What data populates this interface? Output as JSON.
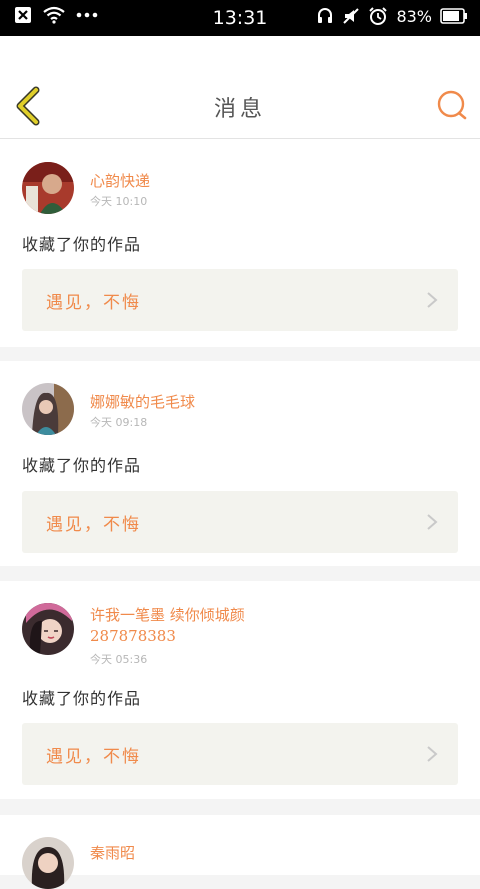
{
  "status_bar": {
    "time": "13:31",
    "battery": "83%"
  },
  "header": {
    "title": "消息"
  },
  "messages": [
    {
      "username": "心韵快递",
      "time": "今天 10:10",
      "action": "收藏了你的作品",
      "work_title": "遇见，不悔"
    },
    {
      "username": "娜娜敏的毛毛球",
      "time": "今天 09:18",
      "action": "收藏了你的作品",
      "work_title": "遇见，不悔"
    },
    {
      "username": "许我一笔墨 续你倾城颜",
      "username_line2": "287878383",
      "time": "今天 05:36",
      "action": "收藏了你的作品",
      "work_title": "遇见，不悔"
    },
    {
      "username": "秦雨昭"
    }
  ],
  "colors": {
    "accent": "#f08a4b",
    "back_arrow": "#e0cf2a",
    "quote_bg": "#f3f3ee"
  },
  "icons": [
    "wifi-icon",
    "more-dots-icon",
    "headphone-icon",
    "mute-icon",
    "alarm-icon",
    "battery-icon",
    "back-arrow-icon",
    "search-icon",
    "chevron-right-icon"
  ]
}
